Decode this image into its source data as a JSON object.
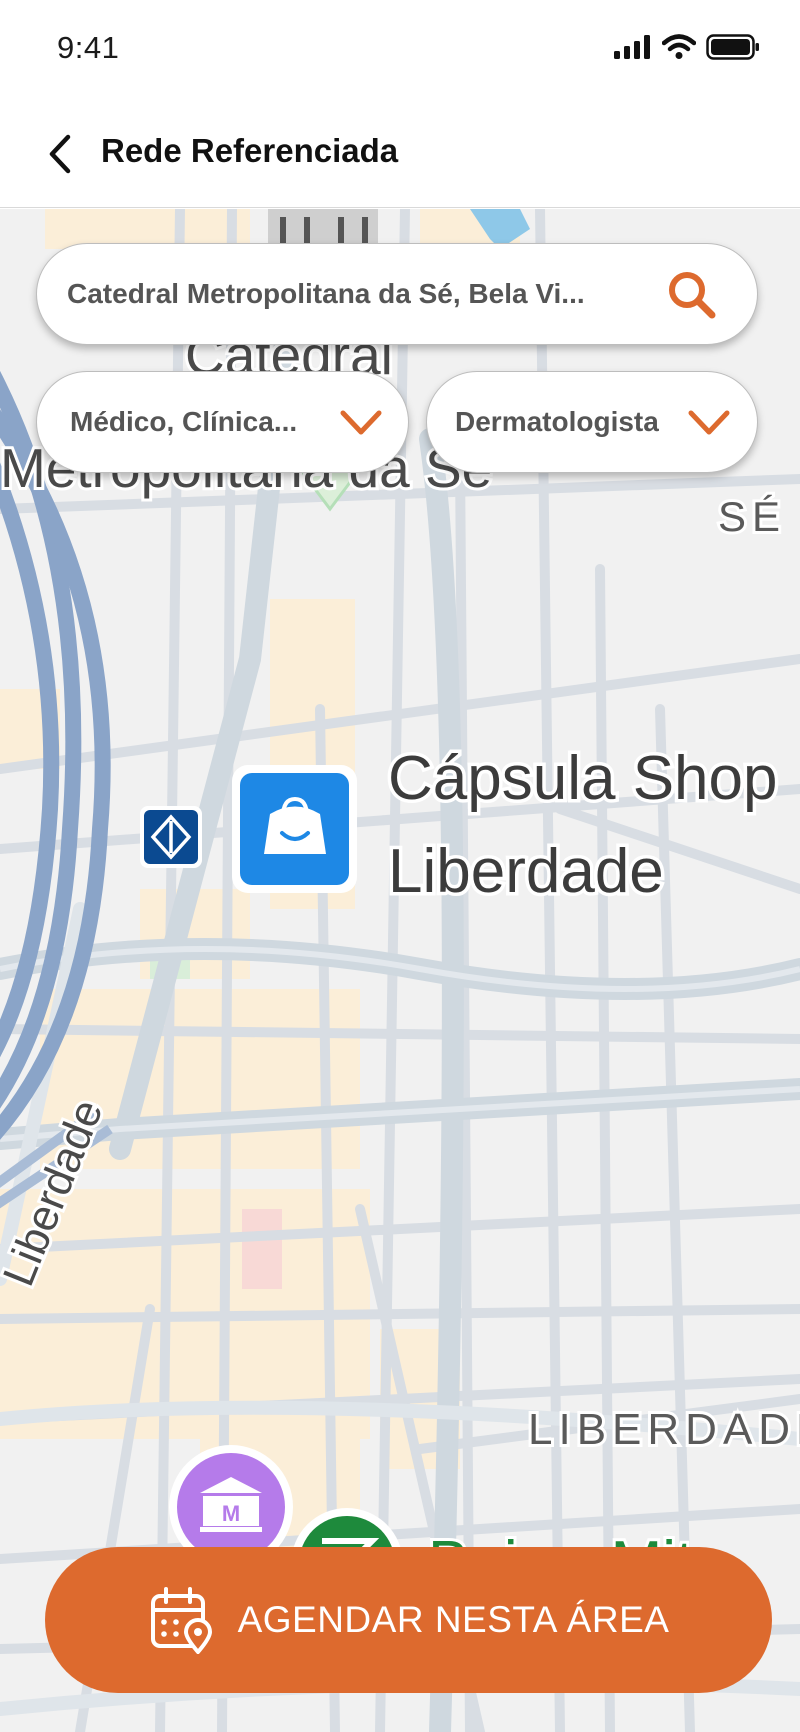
{
  "status_bar": {
    "time": "9:41",
    "signal_icon": "signal-icon",
    "wifi_icon": "wifi-icon",
    "battery_icon": "battery-icon"
  },
  "header": {
    "back_icon": "chevron-left-icon",
    "title": "Rede Referenciada"
  },
  "search": {
    "value": "Catedral Metropolitana da Sé, Bela Vi...",
    "icon": "search-icon"
  },
  "filters": [
    {
      "label": "Médico, Clínica...",
      "icon": "chevron-down-icon"
    },
    {
      "label": "Dermatologista",
      "icon": "chevron-down-icon"
    }
  ],
  "map": {
    "labels": {
      "catedral_line1": "Catedral",
      "catedral_line2": "Metropolitana da Sé",
      "district_se": "SÉ",
      "poi_line1": "Cápsula Shop",
      "poi_line2": "Liberdade",
      "street": "Liberdade",
      "district_liberdade": "LIBERDADE",
      "bottom_poi": "Bairro Mit"
    },
    "pins": [
      "metro-station-icon",
      "shopping-bag-icon",
      "museum-icon",
      "green-poi-icon"
    ]
  },
  "cta": {
    "label": "AGENDAR NESTA ÁREA",
    "icon": "calendar-location-icon"
  },
  "colors": {
    "accent": "#DD6A2E",
    "water": "#8AA4C8",
    "metro": "#0B4A91",
    "poi_blue": "#1E88E5",
    "museum": "#B57BEA",
    "green": "#1E8A3C"
  }
}
